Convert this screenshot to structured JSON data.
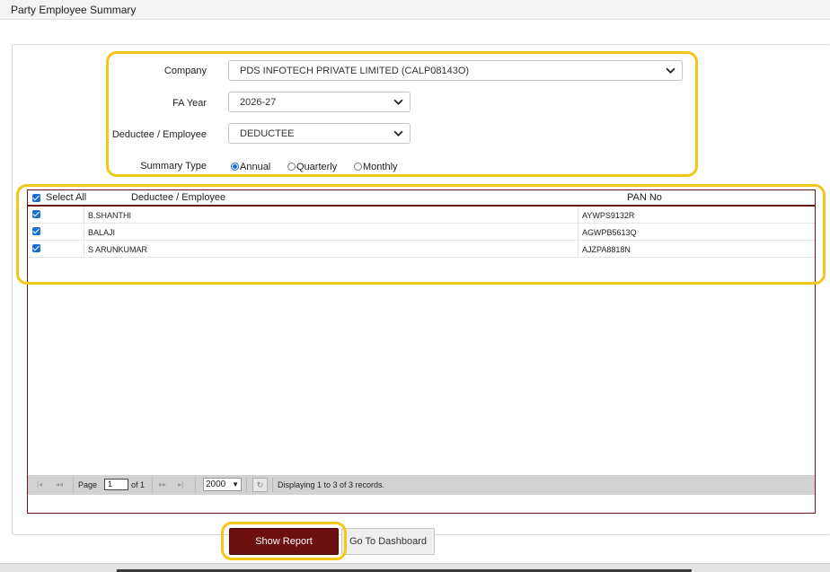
{
  "page": {
    "title": "Party Employee Summary"
  },
  "form": {
    "company_label": "Company",
    "company_value": "PDS INFOTECH PRIVATE LIMITED (CALP08143O)",
    "fa_year_label": "FA Year",
    "fa_year_value": "2026-27",
    "deductee_label": "Deductee / Employee",
    "deductee_value": "DEDUCTEE",
    "summary_type_label": "Summary Type",
    "summary_options": [
      {
        "label": "Annual",
        "selected": true
      },
      {
        "label": "Quarterly",
        "selected": false
      },
      {
        "label": "Monthly",
        "selected": false
      }
    ]
  },
  "grid": {
    "select_all_label": "Select All",
    "col_name": "Deductee / Employee",
    "col_pan": "PAN No",
    "rows": [
      {
        "checked": true,
        "name": "B.SHANTHI",
        "pan": "AYWPS9132R"
      },
      {
        "checked": true,
        "name": "BALAJI",
        "pan": "AGWPB5613Q"
      },
      {
        "checked": true,
        "name": "S ARUNKUMAR",
        "pan": "AJZPA8818N"
      }
    ]
  },
  "pager": {
    "page_label": "Page",
    "page_value": "1",
    "of_label": "of 1",
    "page_size": "2000",
    "status": "Displaying 1 to 3 of 3 records."
  },
  "buttons": {
    "show_report": "Show Report",
    "go_dashboard": "Go To Dashboard"
  },
  "colors": {
    "accent": "#6b0f0f",
    "highlight": "#f5c518",
    "checkbox": "#1a6fd6"
  }
}
